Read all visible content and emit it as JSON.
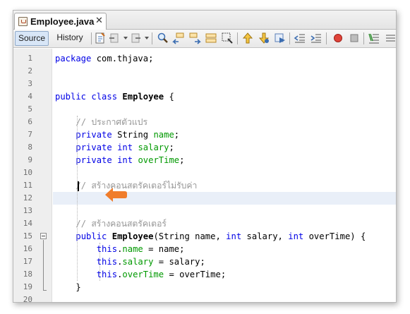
{
  "tab": {
    "filename": "Employee.java",
    "close_glyph": "✕",
    "file_icon": "java-file-icon"
  },
  "toolbar": {
    "source_label": "Source",
    "history_label": "History",
    "icons": [
      "last-edit-icon",
      "back-icon",
      "forward-icon",
      "find-icon",
      "find-previous-icon",
      "find-next-icon",
      "toggle-highlight-icon",
      "find-selection-icon",
      "previous-bookmark-icon",
      "next-bookmark-icon",
      "toggle-bookmark-icon",
      "shift-left-icon",
      "shift-right-icon",
      "start-macro-icon",
      "stop-macro-icon",
      "comment-icon",
      "uncomment-icon"
    ]
  },
  "editor": {
    "current_line": 12,
    "lines": [
      {
        "no": "1",
        "tokens": [
          [
            "kw",
            "package"
          ],
          [
            "t",
            " com.thjava;"
          ]
        ]
      },
      {
        "no": "2",
        "tokens": []
      },
      {
        "no": "3",
        "tokens": []
      },
      {
        "no": "4",
        "tokens": [
          [
            "kw",
            "public"
          ],
          [
            "t",
            " "
          ],
          [
            "kw",
            "class"
          ],
          [
            "t",
            " "
          ],
          [
            "cls",
            "Employee"
          ],
          [
            "t",
            " {"
          ]
        ]
      },
      {
        "no": "5",
        "tokens": []
      },
      {
        "no": "6",
        "tokens": [
          [
            "t",
            "    "
          ],
          [
            "cm",
            "// ประกาศตัวแปร"
          ]
        ]
      },
      {
        "no": "7",
        "tokens": [
          [
            "t",
            "    "
          ],
          [
            "kw",
            "private"
          ],
          [
            "t",
            " String "
          ],
          [
            "fld",
            "name"
          ],
          [
            "t",
            ";"
          ]
        ]
      },
      {
        "no": "8",
        "tokens": [
          [
            "t",
            "    "
          ],
          [
            "kw",
            "private"
          ],
          [
            "t",
            " "
          ],
          [
            "kw",
            "int"
          ],
          [
            "t",
            " "
          ],
          [
            "fld",
            "salary"
          ],
          [
            "t",
            ";"
          ]
        ]
      },
      {
        "no": "9",
        "tokens": [
          [
            "t",
            "    "
          ],
          [
            "kw",
            "private"
          ],
          [
            "t",
            " "
          ],
          [
            "kw",
            "int"
          ],
          [
            "t",
            " "
          ],
          [
            "fld",
            "overTime"
          ],
          [
            "t",
            ";"
          ]
        ]
      },
      {
        "no": "10",
        "tokens": []
      },
      {
        "no": "11",
        "tokens": [
          [
            "t",
            "    "
          ],
          [
            "cm",
            "// สร้างคอนสตรัคเตอร์ไม่รับค่า"
          ]
        ]
      },
      {
        "no": "12",
        "tokens": [
          [
            "t",
            "    "
          ]
        ]
      },
      {
        "no": "13",
        "tokens": []
      },
      {
        "no": "14",
        "tokens": [
          [
            "t",
            "    "
          ],
          [
            "cm",
            "// สร้างคอนสตรัคเตอร์"
          ]
        ]
      },
      {
        "no": "15",
        "tokens": [
          [
            "t",
            "    "
          ],
          [
            "kw",
            "public"
          ],
          [
            "t",
            " "
          ],
          [
            "cls",
            "Employee"
          ],
          [
            "t",
            "(String name, "
          ],
          [
            "kw",
            "int"
          ],
          [
            "t",
            " salary, "
          ],
          [
            "kw",
            "int"
          ],
          [
            "t",
            " overTime) {"
          ]
        ]
      },
      {
        "no": "16",
        "tokens": [
          [
            "t",
            "        "
          ],
          [
            "kw",
            "this"
          ],
          [
            "t",
            "."
          ],
          [
            "fld",
            "name"
          ],
          [
            "t",
            " = name;"
          ]
        ]
      },
      {
        "no": "17",
        "tokens": [
          [
            "t",
            "        "
          ],
          [
            "kw",
            "this"
          ],
          [
            "t",
            "."
          ],
          [
            "fld",
            "salary"
          ],
          [
            "t",
            " = salary;"
          ]
        ]
      },
      {
        "no": "18",
        "tokens": [
          [
            "t",
            "        "
          ],
          [
            "kw",
            "this"
          ],
          [
            "t",
            "."
          ],
          [
            "fld",
            "overTime"
          ],
          [
            "t",
            " = overTime;"
          ]
        ]
      },
      {
        "no": "19",
        "tokens": [
          [
            "t",
            "    }"
          ]
        ]
      },
      {
        "no": "20",
        "tokens": []
      }
    ]
  },
  "annotation": {
    "arrow_color": "#f07d2b",
    "arrow_icon": "orange-arrow-pointer-icon"
  },
  "colors": {
    "keyword": "#0000e6",
    "field": "#009900",
    "comment": "#969696",
    "current_line_bg": "#e9eff8"
  }
}
